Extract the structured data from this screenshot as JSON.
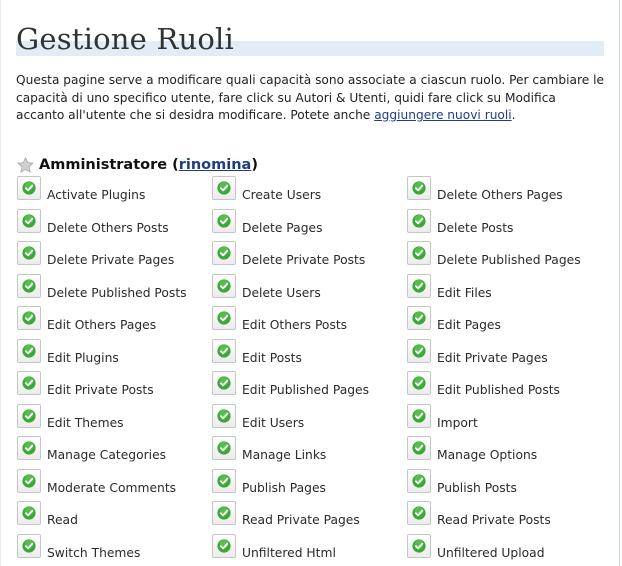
{
  "page": {
    "title": "Gestione Ruoli",
    "intro_text": "Questa pagine serve a modificare quali capacità sono associate a ciascun ruolo. Per cambiare le capacità di uno specifico utente, fare click su Autori & Utenti, quidi fare click su Modifica accanto all'utente che si desidra modificare. Potete anche ",
    "intro_link": "aggiungere nuovi ruoli",
    "intro_end": "."
  },
  "role": {
    "icon": "star-icon",
    "name": "Amministratore",
    "paren_open": "(",
    "rename_link": "rinomina",
    "paren_close": ")"
  },
  "colors": {
    "accent_link": "#1f3c88",
    "title_underline": "#e1ecf6",
    "check_green": "#3aa935"
  },
  "capabilities": [
    {
      "label": "Activate Plugins",
      "checked": true
    },
    {
      "label": "Create Users",
      "checked": true
    },
    {
      "label": "Delete Others Pages",
      "checked": true
    },
    {
      "label": "Delete Others Posts",
      "checked": true
    },
    {
      "label": "Delete Pages",
      "checked": true
    },
    {
      "label": "Delete Posts",
      "checked": true
    },
    {
      "label": "Delete Private Pages",
      "checked": true
    },
    {
      "label": "Delete Private Posts",
      "checked": true
    },
    {
      "label": "Delete Published Pages",
      "checked": true
    },
    {
      "label": "Delete Published Posts",
      "checked": true
    },
    {
      "label": "Delete Users",
      "checked": true
    },
    {
      "label": "Edit Files",
      "checked": true
    },
    {
      "label": "Edit Others Pages",
      "checked": true
    },
    {
      "label": "Edit Others Posts",
      "checked": true
    },
    {
      "label": "Edit Pages",
      "checked": true
    },
    {
      "label": "Edit Plugins",
      "checked": true
    },
    {
      "label": "Edit Posts",
      "checked": true
    },
    {
      "label": "Edit Private Pages",
      "checked": true
    },
    {
      "label": "Edit Private Posts",
      "checked": true
    },
    {
      "label": "Edit Published Pages",
      "checked": true
    },
    {
      "label": "Edit Published Posts",
      "checked": true
    },
    {
      "label": "Edit Themes",
      "checked": true
    },
    {
      "label": "Edit Users",
      "checked": true
    },
    {
      "label": "Import",
      "checked": true
    },
    {
      "label": "Manage Categories",
      "checked": true
    },
    {
      "label": "Manage Links",
      "checked": true
    },
    {
      "label": "Manage Options",
      "checked": true
    },
    {
      "label": "Moderate Comments",
      "checked": true
    },
    {
      "label": "Publish Pages",
      "checked": true
    },
    {
      "label": "Publish Posts",
      "checked": true
    },
    {
      "label": "Read",
      "checked": true
    },
    {
      "label": "Read Private Pages",
      "checked": true
    },
    {
      "label": "Read Private Posts",
      "checked": true
    },
    {
      "label": "Switch Themes",
      "checked": true
    },
    {
      "label": "Unfiltered Html",
      "checked": true
    },
    {
      "label": "Unfiltered Upload",
      "checked": true
    }
  ]
}
